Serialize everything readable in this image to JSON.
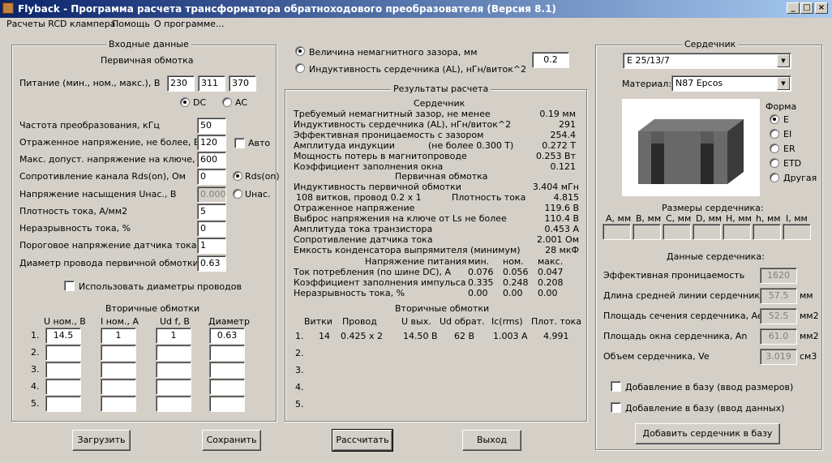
{
  "window": {
    "title": "Flyback - Программа расчета трансформатора обратноходового преобразователя (Версия 8.1)"
  },
  "menu": [
    "Расчеты RCD клампера",
    "Помощь",
    "О программе..."
  ],
  "input": {
    "group_title": "Входные данные",
    "primary_title": "Первичная обмотка",
    "supply_label": "Питание (мин., ном., макс.), В",
    "supply": [
      "230",
      "311",
      "370"
    ],
    "dc": "DC",
    "ac": "AC",
    "rows": [
      {
        "label": "Частота преобразования, кГц",
        "value": "50"
      },
      {
        "label": "Отраженное напряжение, не более, В",
        "value": "120"
      },
      {
        "label": "Макс. допуст. напряжение на ключе, В",
        "value": "600"
      },
      {
        "label": "Сопротивление канала Rds(on), Ом",
        "value": "0"
      },
      {
        "label": "Напряжение насыщения Uнас., В",
        "value": "0.000"
      },
      {
        "label": "Плотность тока, А/мм2",
        "value": "5"
      },
      {
        "label": "Неразрывность тока, %",
        "value": "0"
      },
      {
        "label": "Пороговое напряжение датчика тока, В",
        "value": "1"
      },
      {
        "label": "Диаметр провода первичной обмотки",
        "value": "0.63"
      }
    ],
    "auto": "Авто",
    "rdson": "Rds(on)",
    "usat": "Uнас.",
    "use_diam": "Использовать диаметры проводов",
    "secondary_title": "Вторичные обмотки",
    "sec_headers": [
      "U ном., В",
      "I ном., А",
      "Ud f, В",
      "Диаметр"
    ],
    "sec_rows": [
      [
        "14.5",
        "1",
        "1",
        "0.63"
      ],
      [
        "",
        "",
        "",
        ""
      ],
      [
        "",
        "",
        "",
        ""
      ],
      [
        "",
        "",
        "",
        ""
      ],
      [
        "",
        "",
        "",
        ""
      ]
    ],
    "row_nums": [
      "1.",
      "2.",
      "3.",
      "4.",
      "5."
    ]
  },
  "gap": {
    "opt1": "Величина немагнитного зазора, мм",
    "opt2": "Индуктивность сердечника (AL), нГн/виток^2",
    "value": "0.2"
  },
  "results": {
    "title": "Результаты расчета",
    "core_title": "Сердечник",
    "core": [
      {
        "label": "Требуемый немагнитный зазор, не менее",
        "value": "0.19 мм"
      },
      {
        "label": "Индуктивность сердечника (AL), нГн/виток^2",
        "value": "291"
      },
      {
        "label": "Эффективная проницаемость с зазором",
        "value": "254.4"
      },
      {
        "label": "Амплитуда индукции",
        "mid": "(не более 0.300 Т)",
        "value": "0.272 Т"
      },
      {
        "label": "Мощность потерь в магнитопроводе",
        "value": "0.253 Вт"
      },
      {
        "label": "Коэффициент заполнения окна",
        "value": "0.121"
      }
    ],
    "prim_title": "Первичная обмотка",
    "prim": [
      {
        "label": "Индуктивность первичной обмотки",
        "value": "3.404 мГн"
      },
      {
        "label": "108 витков, провод 0.2 x 1",
        "mid": "Плотность тока",
        "value": "4.815"
      },
      {
        "label": "Отраженное напряжение",
        "value": "119.6 В"
      },
      {
        "label": "Выброс напряжения на ключе от Ls не более",
        "value": "110.4 В"
      },
      {
        "label": "Амплитуда тока транзистора",
        "value": "0.453 А"
      },
      {
        "label": "Сопротивление датчика тока",
        "value": "2.001 Ом"
      },
      {
        "label": "Емкость конденсатора выпрямителя (минимум)",
        "value": "28 мкФ"
      }
    ],
    "supply_hdr": [
      "Напряжение питания",
      "мин.",
      "ном.",
      "макс."
    ],
    "supply_rows": [
      {
        "label": "Ток потребления (по шине DC), А",
        "v": [
          "0.076",
          "0.056",
          "0.047"
        ]
      },
      {
        "label": "Коэффициент заполнения импульса",
        "v": [
          "0.335",
          "0.248",
          "0.208"
        ]
      },
      {
        "label": "Неразрывность тока, %",
        "v": [
          "0.00",
          "0.00",
          "0.00"
        ]
      }
    ],
    "sec_title": "Вторичные обмотки",
    "sec_hdr": [
      "Витки",
      "Провод",
      "U вых.",
      "Ud обрат.",
      "Ic(rms)",
      "Плот. тока"
    ],
    "sec_rows": [
      [
        "14",
        "0.425 x 2",
        "14.50 В",
        "62 В",
        "1.003 А",
        "4.991"
      ],
      [
        "",
        "",
        "",
        "",
        "",
        ""
      ],
      [
        "",
        "",
        "",
        "",
        "",
        ""
      ],
      [
        "",
        "",
        "",
        "",
        "",
        ""
      ],
      [
        "",
        "",
        "",
        "",
        "",
        ""
      ]
    ],
    "row_nums": [
      "1.",
      "2.",
      "3.",
      "4.",
      "5."
    ]
  },
  "core": {
    "title": "Сердечник",
    "type": "E 25/13/7",
    "material_label": "Материал:",
    "material": "N87 Epcos",
    "shape_title": "Форма",
    "shapes": [
      "E",
      "EI",
      "ER",
      "ETD",
      "Другая"
    ],
    "dims_title": "Размеры сердечника:",
    "dims": [
      "A, мм",
      "B, мм",
      "C, мм",
      "D, мм",
      "H, мм",
      "h, мм",
      "I, мм"
    ],
    "data_title": "Данные сердечника:",
    "data": [
      {
        "label": "Эффективная проницаемость",
        "value": "1620",
        "unit": ""
      },
      {
        "label": "Длина средней линии сердечника, le",
        "value": "57.5",
        "unit": "мм"
      },
      {
        "label": "Площадь сечения сердечника, Ae",
        "value": "52.5",
        "unit": "мм2"
      },
      {
        "label": "Площадь окна сердечника, An",
        "value": "61.0",
        "unit": "мм2"
      },
      {
        "label": "Объем сердечника, Ve",
        "value": "3.019",
        "unit": "см3"
      }
    ],
    "add_dims": "Добавление в базу (ввод размеров)",
    "add_data": "Добавление в базу (ввод данных)",
    "add_button": "Добавить сердечник в базу"
  },
  "buttons": {
    "load": "Загрузить",
    "save": "Сохранить",
    "calc": "Рассчитать",
    "exit": "Выход"
  }
}
